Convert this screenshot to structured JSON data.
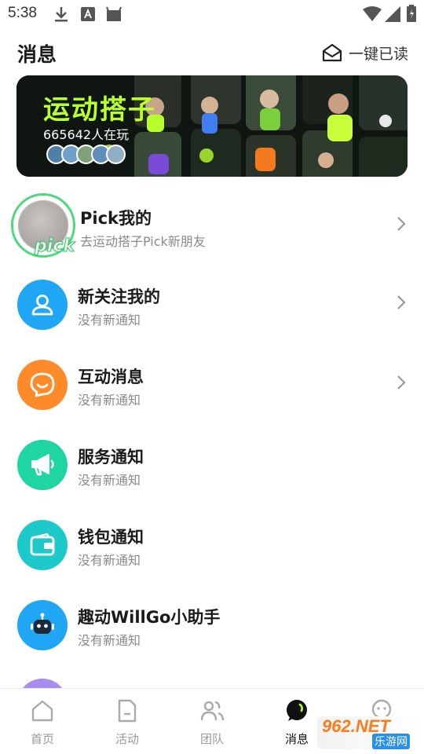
{
  "status_bar": {
    "time": "5:38"
  },
  "header": {
    "title": "消息",
    "mark_all_read": "一键已读"
  },
  "banner": {
    "title": "运动搭子",
    "count_text": "665642人在玩"
  },
  "messages": [
    {
      "title": "Pick我的",
      "subtitle": "去运动搭子Pick新朋友",
      "badge": "pick",
      "has_chevron": true
    },
    {
      "title": "新关注我的",
      "subtitle": "没有新通知",
      "has_chevron": true
    },
    {
      "title": "互动消息",
      "subtitle": "没有新通知",
      "has_chevron": true
    },
    {
      "title": "服务通知",
      "subtitle": "没有新通知",
      "has_chevron": false
    },
    {
      "title": "钱包通知",
      "subtitle": "没有新通知",
      "has_chevron": false
    },
    {
      "title": "趣动WillGo小助手",
      "subtitle": "没有新通知",
      "has_chevron": false
    }
  ],
  "tabs": [
    {
      "label": "首页",
      "active": false
    },
    {
      "label": "活动",
      "active": false
    },
    {
      "label": "团队",
      "active": false
    },
    {
      "label": "消息",
      "active": true
    },
    {
      "label": "",
      "active": false
    }
  ],
  "watermark": {
    "top": "962.NET",
    "bottom": "乐游网"
  },
  "colors": {
    "accent_green": "#b8ff2e",
    "pick_ring": "#4cd97b",
    "icon_blue": "#1fa7f5",
    "icon_orange": "#ff8a2a",
    "icon_mint": "#1fd6a2",
    "icon_teal": "#1ec9c9"
  }
}
